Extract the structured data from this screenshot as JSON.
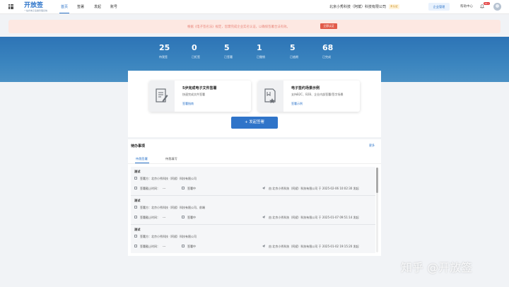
{
  "brand": {
    "name": "开放签",
    "tagline": "一站式电子签章管理系统"
  },
  "nav": {
    "tabs": [
      "首页",
      "签署",
      "发起",
      "账号"
    ],
    "active": 0
  },
  "header": {
    "company": "北京小秀科技（阿斌）科技有限公司",
    "auth_badge": "未认证",
    "manage_button": "企业管理",
    "help": "帮助中心",
    "notification_count": "99+"
  },
  "notice": {
    "text": "根据《电子签名法》规定，您需完成企业实名认证，以确保签署合法有效。",
    "button": "立即认证"
  },
  "stats": [
    {
      "value": "25",
      "label": "待我签"
    },
    {
      "value": "0",
      "label": "已拒签"
    },
    {
      "value": "5",
      "label": "已签署"
    },
    {
      "value": "1",
      "label": "已撤销"
    },
    {
      "value": "5",
      "label": "已逾期"
    },
    {
      "value": "68",
      "label": "已完成"
    }
  ],
  "features": [
    {
      "title": "5步完成电子文件签署",
      "desc": "快速完成文件签署",
      "link": "签署指南"
    },
    {
      "title": "电子签约场景示例",
      "desc": "支持B2C、B2B、企业内部签署/签字场景",
      "link": "签署示例"
    }
  ],
  "start_button": "+ 发起签署",
  "todo": {
    "title": "待办事项",
    "more": "更多",
    "tabs": [
      "待我签署",
      "待我填写"
    ],
    "items": [
      {
        "title": "测试",
        "signer": "签署方：北京小秀科技（阿斌）科技有限公司",
        "deadline": "签署截止时间：",
        "deadline_value": "---",
        "status": "签署中",
        "initiator": "由 北京小秀科技（阿斌）科技有限公司 于 2025-02-06 10:02:30 发起"
      },
      {
        "title": "测试",
        "signer": "签署方：北京小秀科技（阿斌）科技有限公司、前端",
        "deadline": "签署截止时间：",
        "deadline_value": "---",
        "status": "签署中",
        "initiator": "由 北京小秀科技（阿斌）科技有限公司 于 2025-01-07 09:51:14 发起"
      },
      {
        "title": "测试",
        "signer": "签署方：北京小秀科技（阿斌）科技有限公司",
        "deadline": "签署截止时间：",
        "deadline_value": "---",
        "status": "签署中",
        "initiator": "由 北京小秀科技（阿斌）科技有限公司 于 2025-01-02 19:15:20 发起"
      }
    ]
  },
  "watermark": "知乎 @开放签",
  "colors": {
    "primary": "#2b73c9",
    "band": "#2d74b6",
    "notice_bg": "#fde8e2",
    "notice_btn": "#e25a48"
  }
}
